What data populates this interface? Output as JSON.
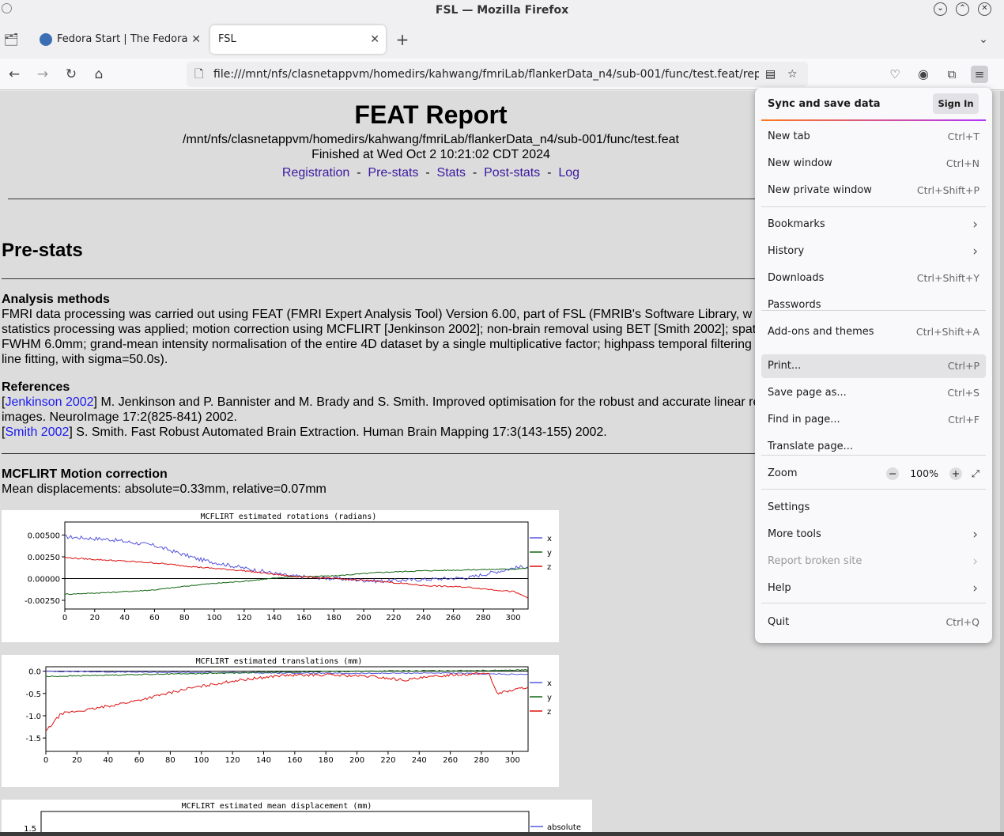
{
  "window": {
    "title": "FSL — Mozilla Firefox"
  },
  "tabs": [
    {
      "label": "Fedora Start | The Fedora Project"
    },
    {
      "label": "FSL"
    }
  ],
  "address_bar": {
    "url": "file:///mnt/nfs/clasnetappvm/homedirs/kahwang/fmriLab/flankerData_n4/sub-001/func/test.feat/report_prestats.html"
  },
  "report": {
    "title": "FEAT Report",
    "path": "/mnt/nfs/clasnetappvm/homedirs/kahwang/fmriLab/flankerData_n4/sub-001/func/test.feat",
    "finished": "Finished at Wed Oct 2 10:21:02 CDT 2024",
    "nav_links": [
      "Registration",
      "Pre-stats",
      "Stats",
      "Post-stats",
      "Log"
    ],
    "nav_sep": "-",
    "section_title": "Pre-stats",
    "analysis_heading": "Analysis methods",
    "analysis_lines": [
      "FMRI data processing was carried out using FEAT (FMRI Expert Analysis Tool) Version 6.00, part of FSL (FMRIB's Software Library, w",
      "statistics processing was applied; motion correction using MCFLIRT [Jenkinson 2002]; non-brain removal using BET [Smith 2002]; spat",
      "FWHM 6.0mm; grand-mean intensity normalisation of the entire 4D dataset by a single multiplicative factor; highpass temporal filtering",
      "line fitting, with sigma=50.0s)."
    ],
    "references_heading": "References",
    "ref1_link": "Jenkinson 2002",
    "ref1_text": "] M. Jenkinson and P. Bannister and M. Brady and S. Smith. Improved optimisation for the robust and accurate linear re",
    "ref1_cont": "images. NeuroImage 17:2(825-841) 2002.",
    "ref2_link": "Smith 2002",
    "ref2_text": "] S. Smith. Fast Robust Automated Brain Extraction. Human Brain Mapping 17:3(143-155) 2002.",
    "open_bracket": "[",
    "mcflirt_heading": "MCFLIRT Motion correction",
    "mean_disp": "Mean displacements: absolute=0.33mm, relative=0.07mm"
  },
  "menu": {
    "sync_label": "Sync and save data",
    "sign_in": "Sign In",
    "items": [
      {
        "label": "New tab",
        "shortcut": "Ctrl+T"
      },
      {
        "label": "New window",
        "shortcut": "Ctrl+N"
      },
      {
        "label": "New private window",
        "shortcut": "Ctrl+Shift+P"
      },
      {
        "label": "Bookmarks",
        "shortcut": ""
      },
      {
        "label": "History",
        "shortcut": ""
      },
      {
        "label": "Downloads",
        "shortcut": "Ctrl+Shift+Y"
      },
      {
        "label": "Passwords",
        "shortcut": ""
      },
      {
        "label": "Add-ons and themes",
        "shortcut": "Ctrl+Shift+A"
      },
      {
        "label": "Print...",
        "shortcut": "Ctrl+P"
      },
      {
        "label": "Save page as...",
        "shortcut": "Ctrl+S"
      },
      {
        "label": "Find in page...",
        "shortcut": "Ctrl+F"
      },
      {
        "label": "Translate page...",
        "shortcut": ""
      },
      {
        "label": "Zoom",
        "shortcut": ""
      },
      {
        "label": "Settings",
        "shortcut": ""
      },
      {
        "label": "More tools",
        "shortcut": ""
      },
      {
        "label": "Report broken site",
        "shortcut": ""
      },
      {
        "label": "Help",
        "shortcut": ""
      },
      {
        "label": "Quit",
        "shortcut": "Ctrl+Q"
      }
    ],
    "zoom_level": "100%",
    "zoom_minus": "−",
    "zoom_plus": "+"
  },
  "chart_data": [
    {
      "type": "line",
      "title": "MCFLIRT estimated rotations (radians)",
      "xlim": [
        0,
        310
      ],
      "ylim": [
        -0.0035,
        0.0065
      ],
      "x_ticks": [
        0,
        20,
        40,
        60,
        80,
        100,
        120,
        140,
        160,
        180,
        200,
        220,
        240,
        260,
        280,
        300
      ],
      "y_ticks": [
        "0.00500",
        "0.00250",
        "0.00000",
        "-0.00250"
      ],
      "series": [
        {
          "name": "x",
          "color": "#5555dd",
          "values": [
            [
              0,
              0.0048
            ],
            [
              30,
              0.0045
            ],
            [
              60,
              0.0038
            ],
            [
              90,
              0.0022
            ],
            [
              120,
              0.0012
            ],
            [
              150,
              0.0003
            ],
            [
              180,
              0.0
            ],
            [
              210,
              -0.0003
            ],
            [
              240,
              -0.0001
            ],
            [
              270,
              0.0001
            ],
            [
              300,
              0.0012
            ],
            [
              310,
              0.0014
            ]
          ]
        },
        {
          "name": "y",
          "color": "#116611",
          "values": [
            [
              0,
              -0.0018
            ],
            [
              30,
              -0.0016
            ],
            [
              60,
              -0.0013
            ],
            [
              90,
              -0.0007
            ],
            [
              120,
              -0.0003
            ],
            [
              150,
              0.0002
            ],
            [
              180,
              0.0003
            ],
            [
              210,
              0.0007
            ],
            [
              240,
              0.0009
            ],
            [
              270,
              0.001
            ],
            [
              300,
              0.0011
            ],
            [
              310,
              0.0012
            ]
          ]
        },
        {
          "name": "z",
          "color": "#dd1111",
          "values": [
            [
              0,
              0.0024
            ],
            [
              30,
              0.0021
            ],
            [
              60,
              0.0018
            ],
            [
              90,
              0.0013
            ],
            [
              120,
              0.0009
            ],
            [
              150,
              0.0003
            ],
            [
              180,
              0.0
            ],
            [
              210,
              -0.0003
            ],
            [
              240,
              -0.0008
            ],
            [
              270,
              -0.001
            ],
            [
              300,
              -0.0015
            ],
            [
              310,
              -0.0022
            ]
          ]
        }
      ]
    },
    {
      "type": "line",
      "title": "MCFLIRT estimated translations (mm)",
      "xlim": [
        0,
        310
      ],
      "ylim": [
        -1.8,
        0.1
      ],
      "x_ticks": [
        0,
        20,
        40,
        60,
        80,
        100,
        120,
        140,
        160,
        180,
        200,
        220,
        240,
        260,
        280,
        300
      ],
      "y_ticks": [
        "0.0",
        "-0.5",
        "-1.0",
        "-1.5"
      ],
      "series": [
        {
          "name": "x",
          "color": "#5555dd",
          "values": [
            [
              0,
              0.0
            ],
            [
              50,
              -0.02
            ],
            [
              100,
              -0.03
            ],
            [
              150,
              -0.04
            ],
            [
              200,
              -0.05
            ],
            [
              250,
              -0.04
            ],
            [
              300,
              -0.07
            ],
            [
              310,
              -0.08
            ]
          ]
        },
        {
          "name": "y",
          "color": "#116611",
          "values": [
            [
              0,
              -0.12
            ],
            [
              50,
              -0.08
            ],
            [
              100,
              -0.05
            ],
            [
              150,
              -0.02
            ],
            [
              200,
              0.0
            ],
            [
              250,
              0.01
            ],
            [
              300,
              0.02
            ],
            [
              310,
              0.03
            ]
          ]
        },
        {
          "name": "z",
          "color": "#dd1111",
          "values": [
            [
              0,
              -1.35
            ],
            [
              10,
              -0.95
            ],
            [
              30,
              -0.85
            ],
            [
              60,
              -0.65
            ],
            [
              90,
              -0.4
            ],
            [
              120,
              -0.22
            ],
            [
              150,
              -0.1
            ],
            [
              180,
              -0.08
            ],
            [
              210,
              -0.12
            ],
            [
              230,
              -0.2
            ],
            [
              260,
              -0.08
            ],
            [
              285,
              -0.05
            ],
            [
              290,
              -0.5
            ],
            [
              310,
              -0.35
            ]
          ]
        }
      ]
    },
    {
      "type": "line",
      "title": "MCFLIRT estimated mean displacement (mm)",
      "series": [
        {
          "name": "absolute",
          "color": "#5555dd",
          "values": []
        }
      ],
      "y_ticks": [
        "1.5"
      ]
    }
  ]
}
